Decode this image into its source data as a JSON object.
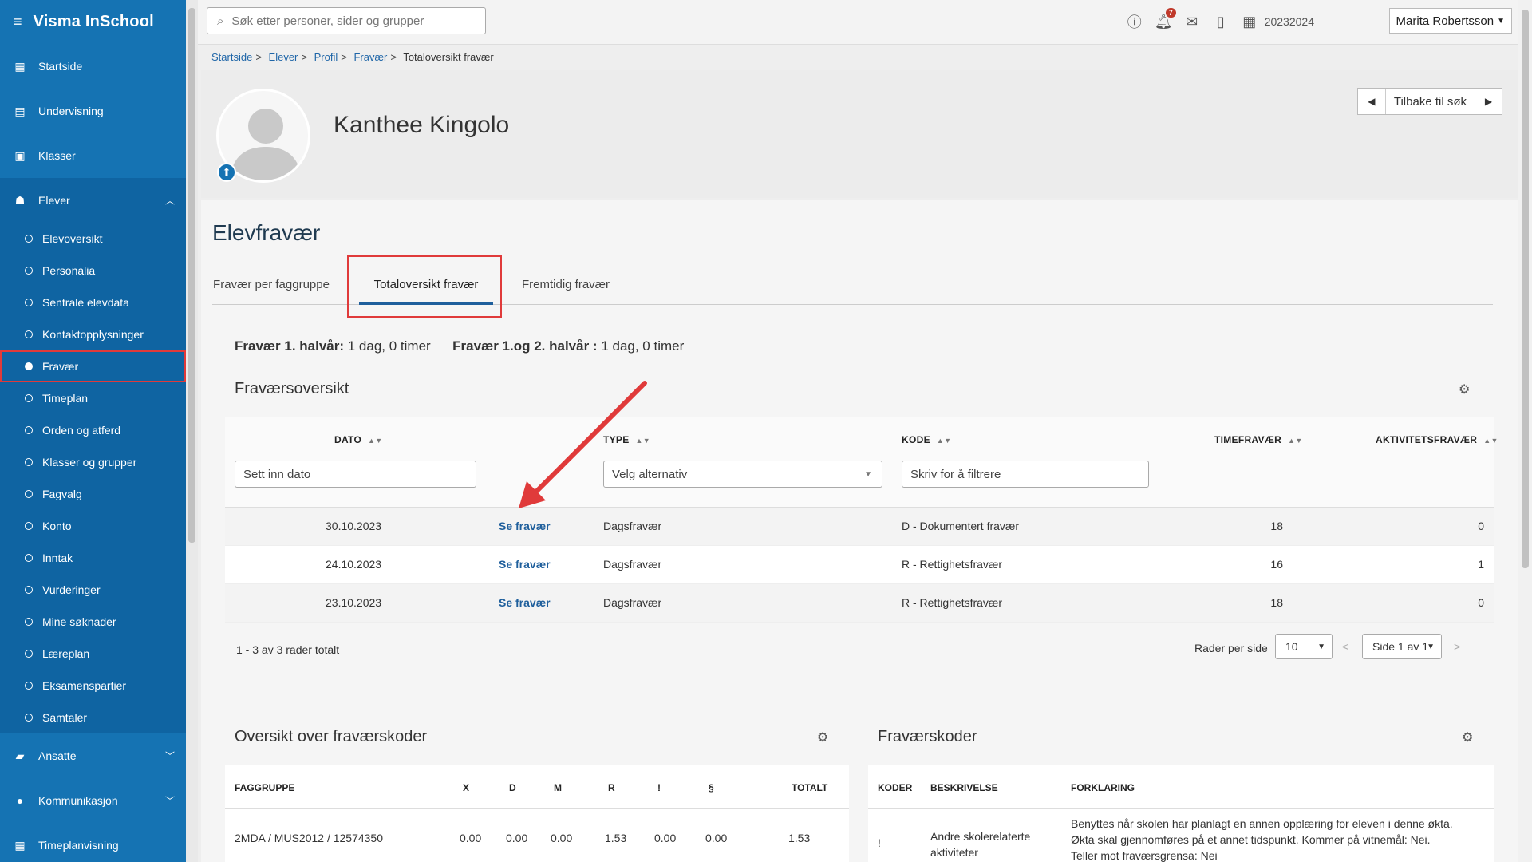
{
  "app": {
    "title": "Visma InSchool"
  },
  "sidebar": {
    "top_items": [
      {
        "label": "Startside",
        "icon": "grid-icon"
      },
      {
        "label": "Undervisning",
        "icon": "book-icon"
      },
      {
        "label": "Klasser",
        "icon": "classroom-icon"
      }
    ],
    "elever": {
      "label": "Elever",
      "icon": "student-icon"
    },
    "sub_items": [
      "Elevoversikt",
      "Personalia",
      "Sentrale elevdata",
      "Kontaktopplysninger",
      "Fravær",
      "Timeplan",
      "Orden og atferd",
      "Klasser og grupper",
      "Fagvalg",
      "Konto",
      "Inntak",
      "Vurderinger",
      "Mine søknader",
      "Læreplan",
      "Eksamenspartier",
      "Samtaler"
    ],
    "active_sub": "Fravær",
    "bottom_items": [
      {
        "label": "Ansatte",
        "icon": "briefcase-icon"
      },
      {
        "label": "Kommunikasjon",
        "icon": "chat-icon"
      },
      {
        "label": "Timeplanvisning",
        "icon": "calendar-icon"
      }
    ]
  },
  "topbar": {
    "search_placeholder": "Søk etter personer, sider og grupper",
    "notification_count": "7",
    "school_year": "20232024",
    "user_name": "Marita Robertsson"
  },
  "breadcrumb": {
    "items": [
      "Startside",
      "Elever",
      "Profil",
      "Fravær"
    ],
    "current": "Totaloversikt fravær"
  },
  "profile": {
    "name": "Kanthee Kingolo",
    "back_label": "Tilbake til søk"
  },
  "page": {
    "title": "Elevfravær",
    "tabs": [
      "Fravær per faggruppe",
      "Totaloversikt fravær",
      "Fremtidig fravær"
    ],
    "active_tab": "Totaloversikt fravær",
    "summary": [
      {
        "label": "Fravær 1. halvår:",
        "value": "1 dag, 0 timer"
      },
      {
        "label": "Fravær 1.og 2. halvår :",
        "value": "1 dag, 0 timer"
      }
    ]
  },
  "fravaersoversikt": {
    "title": "Fraværsoversikt",
    "columns": {
      "dato": "DATO",
      "type": "TYPE",
      "kode": "KODE",
      "time": "TIMEFRAVÆR",
      "aktivitet": "AKTIVITETSFRAVÆR"
    },
    "filters": {
      "dato": "Sett inn dato",
      "type": "Velg alternativ",
      "kode": "Skriv for å filtrere"
    },
    "rows": [
      {
        "dato": "30.10.2023",
        "link": "Se fravær",
        "type": "Dagsfravær",
        "kode": "D - Dokumentert fravær",
        "time": "18",
        "aktivitet": "0"
      },
      {
        "dato": "24.10.2023",
        "link": "Se fravær",
        "type": "Dagsfravær",
        "kode": "R - Rettighetsfravær",
        "time": "16",
        "aktivitet": "1"
      },
      {
        "dato": "23.10.2023",
        "link": "Se fravær",
        "type": "Dagsfravær",
        "kode": "R - Rettighetsfravær",
        "time": "18",
        "aktivitet": "0"
      }
    ],
    "total_text": "1 - 3 av 3 rader totalt",
    "rows_per_page_label": "Rader per side",
    "rows_per_page": "10",
    "page_label": "Side 1 av 1"
  },
  "koder_oversikt": {
    "title": "Oversikt over fraværskoder",
    "columns": [
      "FAGGRUPPE",
      "X",
      "D",
      "M",
      "R",
      "!",
      "§",
      "TOTALT"
    ],
    "row": [
      "2MDA / MUS2012 / 12574350",
      "0.00",
      "0.00",
      "0.00",
      "1.53",
      "0.00",
      "0.00",
      "1.53"
    ]
  },
  "fravaerskoder": {
    "title": "Fraværskoder",
    "columns": [
      "KODER",
      "BESKRIVELSE",
      "FORKLARING"
    ],
    "row": {
      "kode": "!",
      "beskrivelse": [
        "Andre skolerelaterte",
        "aktiviteter"
      ],
      "forklaring": [
        "Benyttes når skolen har planlagt en annen opplæring for eleven i denne økta.",
        "Økta skal gjennomføres på et annet tidspunkt. Kommer på vitnemål: Nei.",
        "Teller mot fraværsgrensa: Nei"
      ]
    }
  },
  "colors": {
    "sidebar": "#1573b3",
    "sidebar_section": "#0f64a2",
    "highlight": "#e03a3a",
    "link": "#1f5f9c"
  }
}
